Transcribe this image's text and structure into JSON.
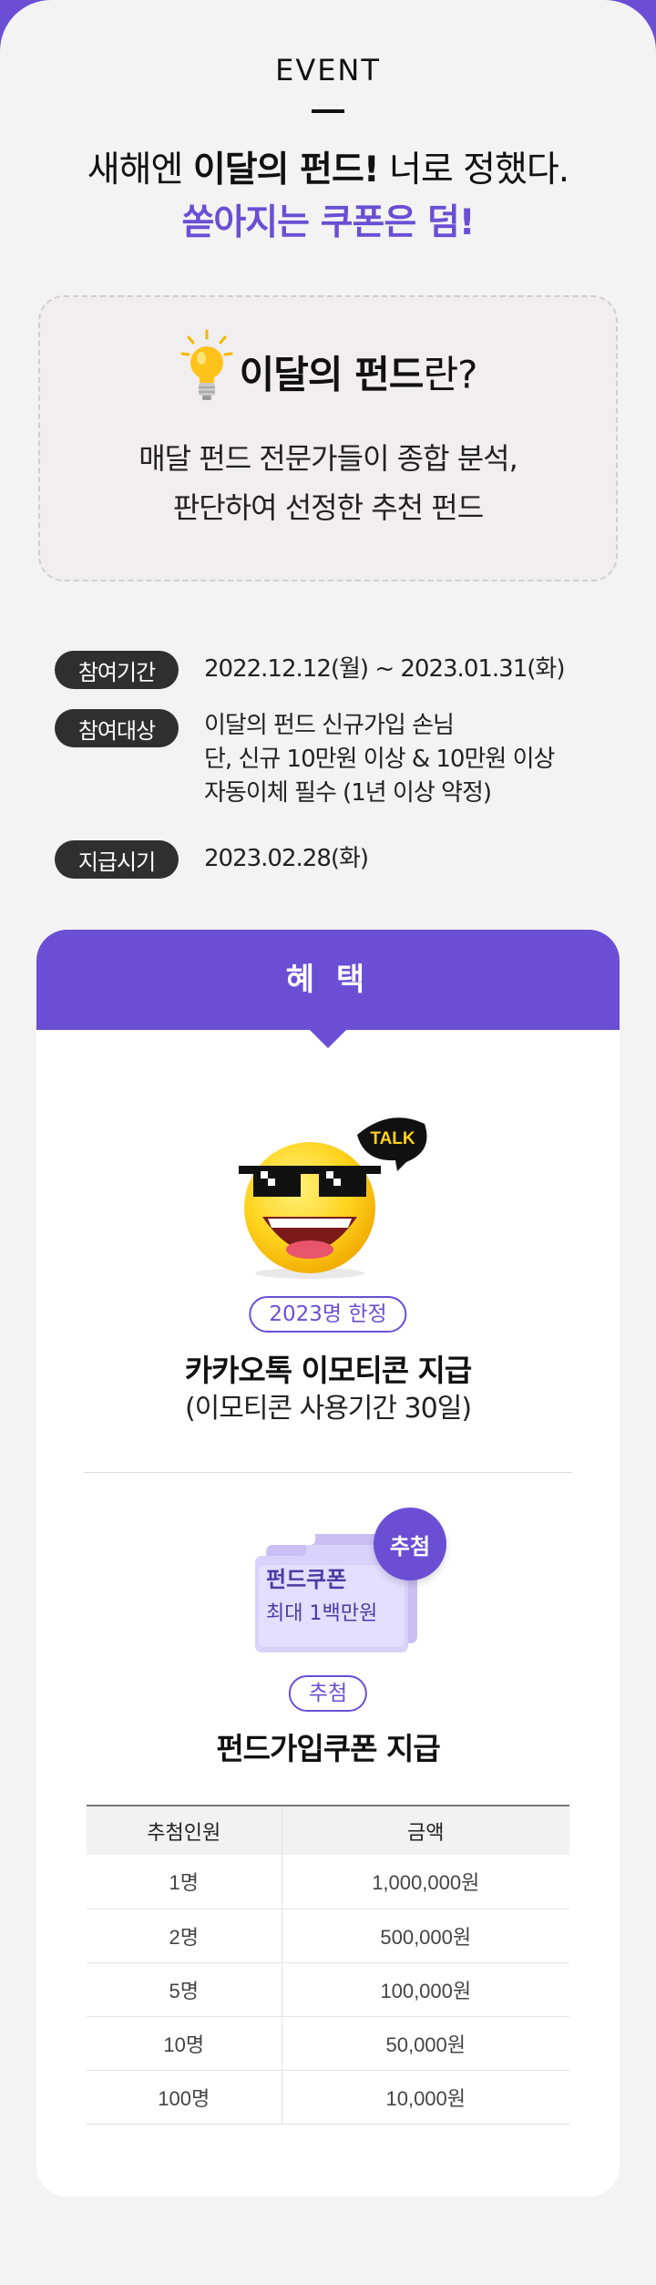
{
  "header": {
    "event_label": "EVENT",
    "headline_part1": "새해엔 ",
    "headline_bold": "이달의 펀드!",
    "headline_part2": " 너로 정했다.",
    "headline_line2": "쏟아지는 쿠폰은 덤!"
  },
  "info_box": {
    "title_bold": "이달의 펀드",
    "title_rest": "란?",
    "desc_line1": "매달 펀드 전문가들이 종합 분석,",
    "desc_line2": "판단하여 선정한 추천 펀드"
  },
  "schedule": {
    "period_label": "참여기간",
    "period_value": "2022.12.12(월) ~ 2023.01.31(화)",
    "target_label": "참여대상",
    "target_line1": "이달의 펀드 신규가입 손님",
    "target_line2": "단, 신규 10만원 이상 & 10만원 이상",
    "target_line3": "자동이체 필수 (1년 이상 약정)",
    "payment_label": "지급시기",
    "payment_value": "2023.02.28(화)"
  },
  "benefit": {
    "header": "혜 택",
    "talk_badge": "TALK",
    "limit_pill": "2023명 한정",
    "emoticon_title": "카카오톡 이모티콘 지급",
    "emoticon_sub": "(이모티콘 사용기간 30일)",
    "coupon_title": "펀드쿠폰",
    "coupon_sub": "최대 1백만원",
    "coupon_badge": "추첨",
    "raffle_pill": "추첨",
    "coupon_benefit_title": "펀드가입쿠폰 지급"
  },
  "prize_table": {
    "headers": [
      "추첨인원",
      "금액"
    ],
    "rows": [
      [
        "1명",
        "1,000,000원"
      ],
      [
        "2명",
        "500,000원"
      ],
      [
        "5명",
        "100,000원"
      ],
      [
        "10명",
        "50,000원"
      ],
      [
        "100명",
        "10,000원"
      ]
    ]
  },
  "colors": {
    "accent": "#6a4fd4",
    "pill_dark": "#2f2f2f",
    "page_bg": "#f3f3f3"
  }
}
